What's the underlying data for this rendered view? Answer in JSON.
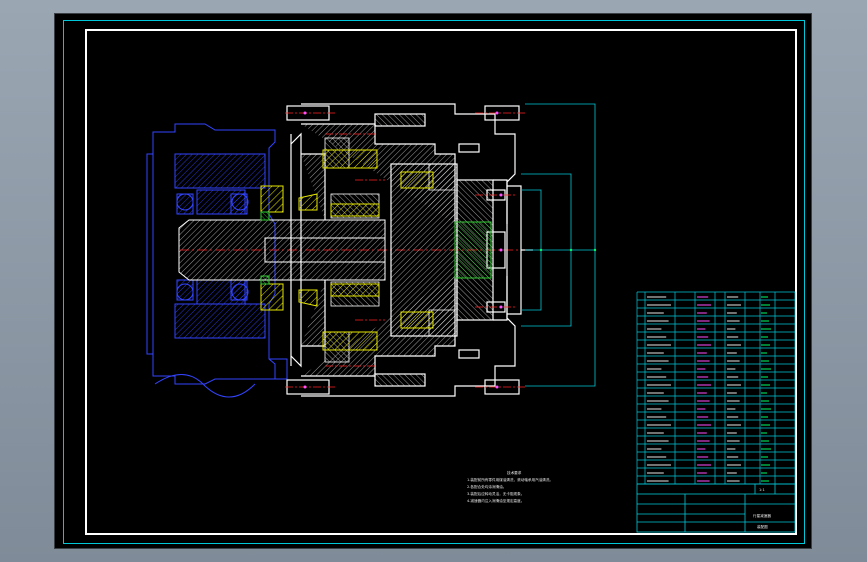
{
  "drawing": {
    "notes_title": "技术要求",
    "notes": [
      "1.装配前所有零件用煤油清洗，滚动轴承用汽油清洗。",
      "2.各配合处均涂润滑油。",
      "3.装配后应转动灵活，无卡阻现象。",
      "4.减速器内注入润滑油至规定高度。"
    ],
    "title_block": {
      "name": "行星减速器",
      "drawing_no": "装配图",
      "scale": "1:1"
    },
    "colors": {
      "frame": "#00c8d8",
      "outline": "#ffffff",
      "hatch_yellow": "#e6e600",
      "bearing_blue": "#3333ff",
      "center_red": "#ff2020",
      "dim_cyan": "#00c8d8",
      "text_green": "#00ff66"
    }
  }
}
